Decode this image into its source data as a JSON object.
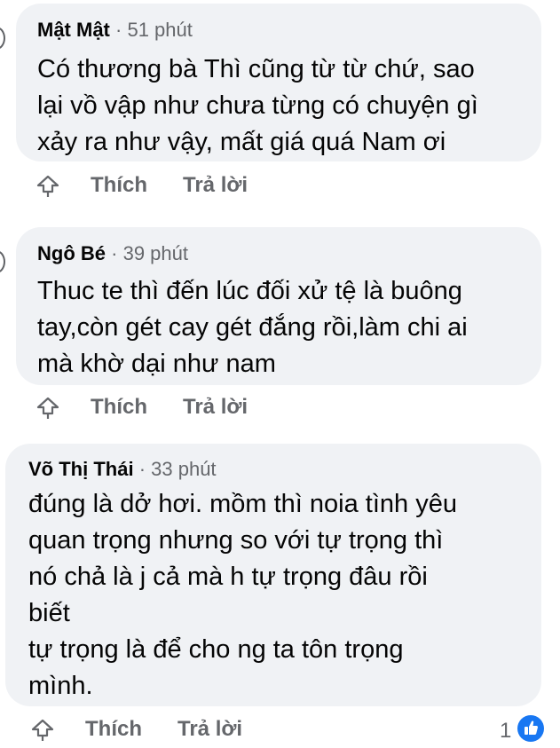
{
  "comments": [
    {
      "author": "Mật Mật",
      "separator": "·",
      "time": "51 phút",
      "text": "Có thương bà Thì cũng từ từ chứ, sao\nlại vồ vập như chưa từng có chuyện gì\nxảy ra như vậy, mất giá quá Nam ơi",
      "like_label": "Thích",
      "reply_label": "Trả lời"
    },
    {
      "author": "Ngô Bé",
      "separator": "·",
      "time": "39 phút",
      "text": "Thuc te thì đến lúc đối xử tệ là buông\ntay,còn gét cay gét đắng rồi,làm chi ai\nmà khờ dại như nam",
      "like_label": "Thích",
      "reply_label": "Trả lời"
    },
    {
      "author": "Võ Thị Thái",
      "separator": "·",
      "time": "33 phút",
      "text": "đúng là dở hơi. mồm thì noia tình yêu\nquan trọng nhưng so với tự trọng thì\nnó chả là j cả mà h tự trọng đâu rồi\nbiết\ntự trọng là để cho ng ta tôn trọng\nmình.",
      "like_label": "Thích",
      "reply_label": "Trả lời",
      "reaction_count": "1"
    }
  ],
  "icons": {
    "share": "share-arrow-icon",
    "like_reaction": "thumbs-up-icon"
  },
  "colors": {
    "bubble_bg": "#f0f2f5",
    "text": "#050505",
    "secondary": "#65676b",
    "like_blue": "#1877f2"
  }
}
